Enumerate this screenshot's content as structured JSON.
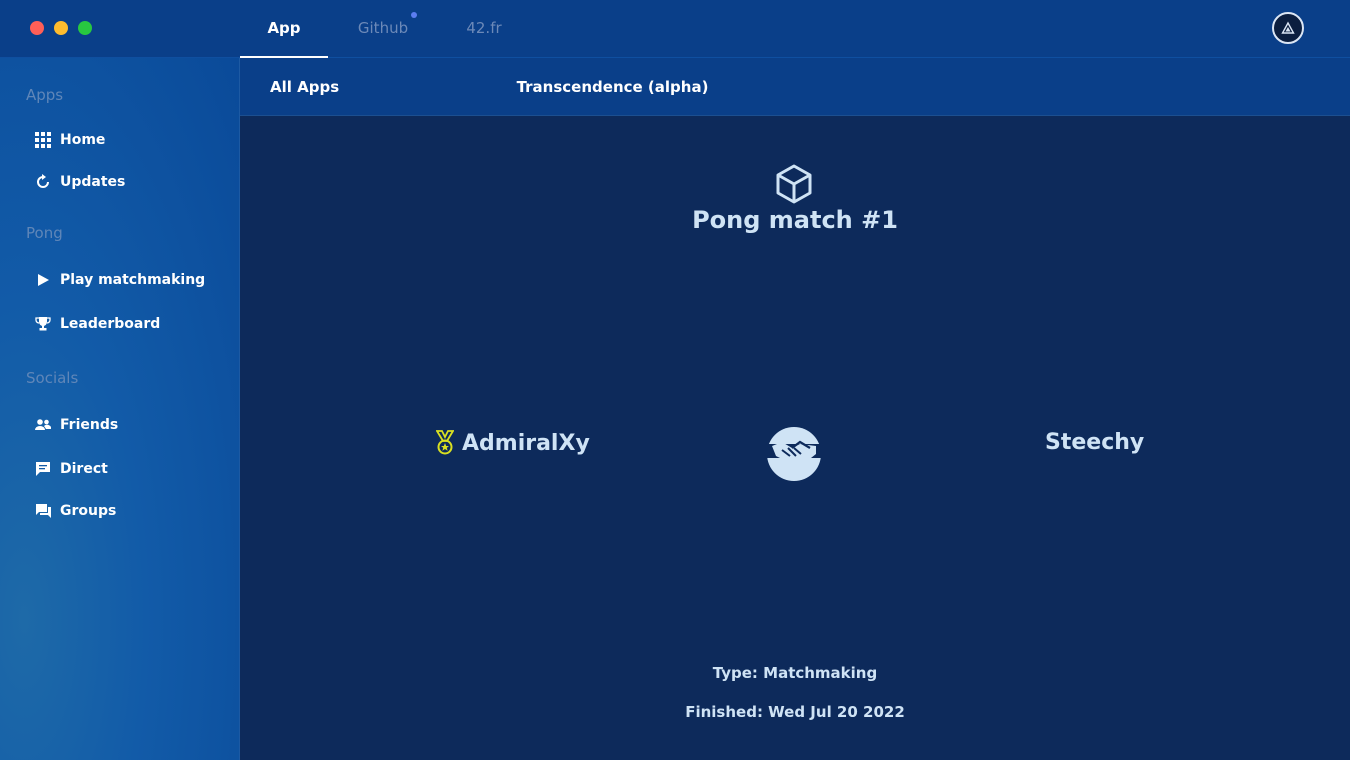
{
  "window": {
    "top_tabs": [
      {
        "label": "App",
        "active": true
      },
      {
        "label": "Github",
        "active": false,
        "has_notification": true
      },
      {
        "label": "42.fr",
        "active": false
      }
    ]
  },
  "sidebar": {
    "sections": [
      {
        "label": "Apps",
        "items": [
          {
            "label": "Home",
            "icon": "grid-icon"
          },
          {
            "label": "Updates",
            "icon": "refresh-icon"
          }
        ]
      },
      {
        "label": "Pong",
        "items": [
          {
            "label": "Play matchmaking",
            "icon": "play-icon"
          },
          {
            "label": "Leaderboard",
            "icon": "trophy-icon"
          }
        ]
      },
      {
        "label": "Socials",
        "items": [
          {
            "label": "Friends",
            "icon": "people-icon"
          },
          {
            "label": "Direct",
            "icon": "chat-bubble-icon"
          },
          {
            "label": "Groups",
            "icon": "group-chat-icon"
          }
        ]
      }
    ]
  },
  "subtabs": [
    {
      "label": "All Apps",
      "selected": false
    },
    {
      "label": "Transcendence (alpha)",
      "selected": true
    }
  ],
  "match": {
    "title": "Pong match #1",
    "player_left": "AdmiralXy",
    "player_right": "Steechy",
    "winner_icon": "medal-icon",
    "result_icon": "handshake-icon",
    "type_text": "Type: Matchmaking",
    "finished_text": "Finished: Wed Jul 20 2022"
  },
  "colors": {
    "topbar": "#0a3f89",
    "main_bg": "#0d2a5b",
    "text_accent": "#cfe3f5",
    "medal": "#d9e021"
  }
}
